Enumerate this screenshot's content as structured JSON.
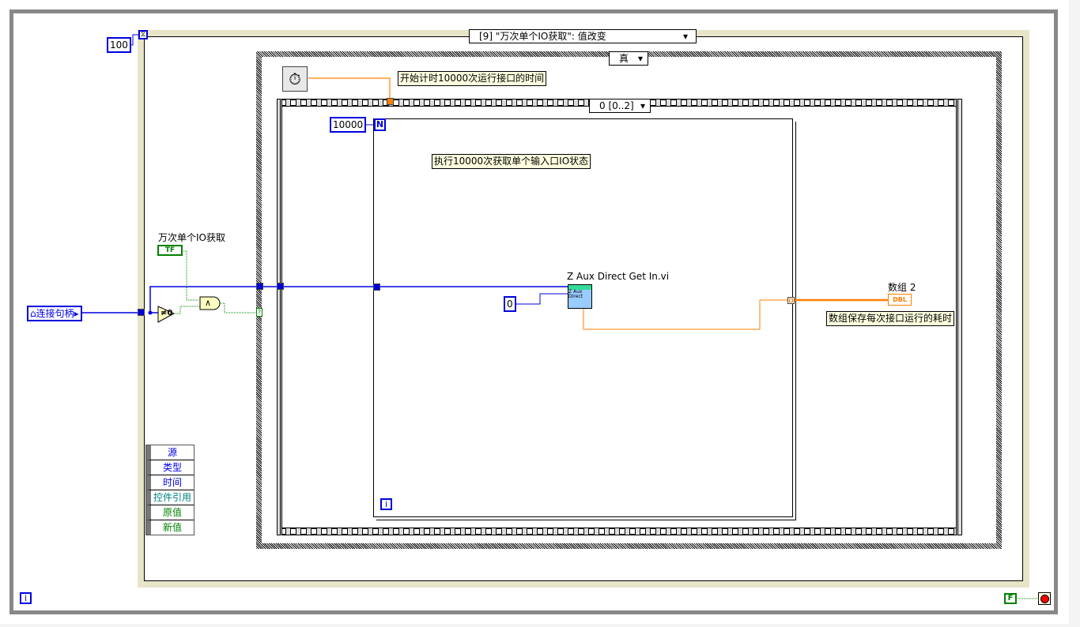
{
  "while_loop": {
    "wait_ms": "100",
    "iteration_label": "i",
    "stop_constant": "F",
    "stop_icon": "stop-button-icon"
  },
  "event_structure": {
    "selector": "[9] \"万次单个IO获取\": 值改变",
    "event_data_nodes": [
      "源",
      "类型",
      "时间",
      "控件引用",
      "原值",
      "新值"
    ],
    "event_data_colors": [
      "#0000e0",
      "#0000e0",
      "#0000e0",
      "#008080",
      "#008000",
      "#008000"
    ]
  },
  "case_structure": {
    "selector": "真"
  },
  "sequence": {
    "selector": "0 [0..2]"
  },
  "for_loop": {
    "count": "10000",
    "count_terminal": "N",
    "iteration_label": "i"
  },
  "controls": {
    "handle_label": "连接句柄",
    "bool_label": "万次单个IO获取",
    "bool_glyph": "TF",
    "not_equal_zero": "≠0",
    "and_glyph": "∧",
    "case_selector_glyph": "?"
  },
  "comments": {
    "start_timer": "开始计时10000次运行接口的时间",
    "loop_desc": "执行10000次获取单个输入口IO状态",
    "array_desc": "数组保存每次接口运行的耗时"
  },
  "subvi": {
    "name": "Z Aux Direct Get In.vi",
    "input_const": "0",
    "icon_text": "Z Aux Direct"
  },
  "indicator": {
    "label": "数组 2",
    "type": "DBL"
  },
  "colors": {
    "wire_refnum": "#0000e0",
    "wire_dbl": "#ff8000",
    "wire_bool": "#008000"
  }
}
